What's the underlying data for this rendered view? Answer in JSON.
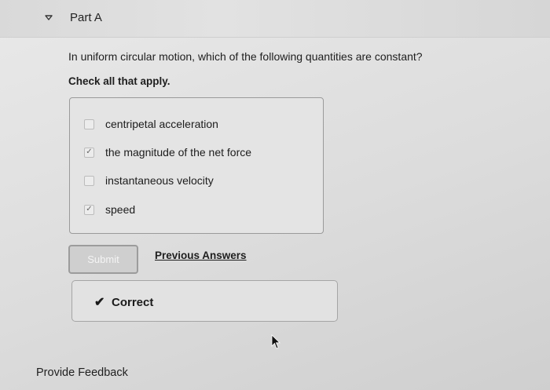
{
  "part": {
    "toggle_icon": "triangle-down-icon",
    "title": "Part A"
  },
  "question": {
    "text": "In uniform circular motion, which of the following quantities are constant?",
    "instruction": "Check all that apply."
  },
  "options": [
    {
      "label": "centripetal acceleration",
      "checked": false
    },
    {
      "label": "the magnitude of the net force",
      "checked": true
    },
    {
      "label": "instantaneous velocity",
      "checked": false
    },
    {
      "label": "speed",
      "checked": true
    }
  ],
  "actions": {
    "submit_label": "Submit",
    "previous_answers_label": "Previous Answers"
  },
  "result": {
    "icon": "checkmark-icon",
    "text": "Correct"
  },
  "footer": {
    "feedback_label": "Provide Feedback"
  }
}
